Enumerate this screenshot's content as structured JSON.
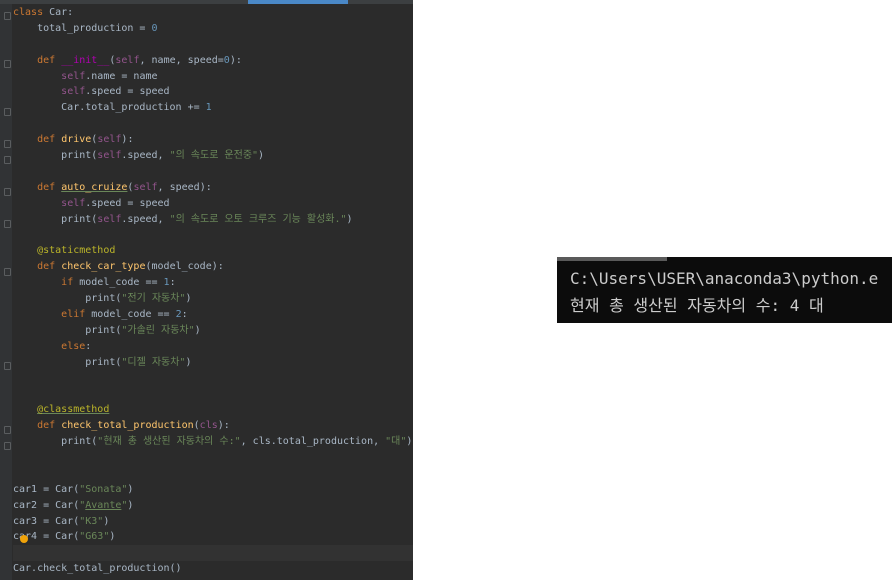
{
  "editor": {
    "lines": [
      [
        {
          "c": "kw",
          "t": "class "
        },
        {
          "c": "",
          "t": "Car:"
        }
      ],
      [
        {
          "c": "",
          "t": "    total_production = "
        },
        {
          "c": "num",
          "t": "0"
        }
      ],
      [],
      [
        {
          "c": "",
          "t": "    "
        },
        {
          "c": "kw",
          "t": "def "
        },
        {
          "c": "magic",
          "t": "__init__"
        },
        {
          "c": "",
          "t": "("
        },
        {
          "c": "self",
          "t": "self"
        },
        {
          "c": "",
          "t": ", name, speed="
        },
        {
          "c": "num",
          "t": "0"
        },
        {
          "c": "",
          "t": "):"
        }
      ],
      [
        {
          "c": "",
          "t": "        "
        },
        {
          "c": "self",
          "t": "self"
        },
        {
          "c": "",
          "t": ".name = name"
        }
      ],
      [
        {
          "c": "",
          "t": "        "
        },
        {
          "c": "self",
          "t": "self"
        },
        {
          "c": "",
          "t": ".speed = speed"
        }
      ],
      [
        {
          "c": "",
          "t": "        Car.total_production += "
        },
        {
          "c": "num",
          "t": "1"
        }
      ],
      [],
      [
        {
          "c": "",
          "t": "    "
        },
        {
          "c": "kw",
          "t": "def "
        },
        {
          "c": "fn",
          "t": "drive"
        },
        {
          "c": "",
          "t": "("
        },
        {
          "c": "self",
          "t": "self"
        },
        {
          "c": "",
          "t": "):"
        }
      ],
      [
        {
          "c": "",
          "t": "        print("
        },
        {
          "c": "self",
          "t": "self"
        },
        {
          "c": "",
          "t": ".speed, "
        },
        {
          "c": "str",
          "t": "\"의 속도로 운전중\""
        },
        {
          "c": "",
          "t": ")"
        }
      ],
      [],
      [
        {
          "c": "",
          "t": "    "
        },
        {
          "c": "kw",
          "t": "def "
        },
        {
          "c": "fn warn",
          "t": "auto_cruize"
        },
        {
          "c": "",
          "t": "("
        },
        {
          "c": "self",
          "t": "self"
        },
        {
          "c": "",
          "t": ", speed):"
        }
      ],
      [
        {
          "c": "",
          "t": "        "
        },
        {
          "c": "self",
          "t": "self"
        },
        {
          "c": "",
          "t": ".speed = speed"
        }
      ],
      [
        {
          "c": "",
          "t": "        print("
        },
        {
          "c": "self",
          "t": "self"
        },
        {
          "c": "",
          "t": ".speed, "
        },
        {
          "c": "str",
          "t": "\"의 속도로 오토 크루즈 기능 활성화.\""
        },
        {
          "c": "",
          "t": ")"
        }
      ],
      [],
      [
        {
          "c": "",
          "t": "    "
        },
        {
          "c": "dec",
          "t": "@staticmethod"
        }
      ],
      [
        {
          "c": "",
          "t": "    "
        },
        {
          "c": "kw",
          "t": "def "
        },
        {
          "c": "fn",
          "t": "check_car_type"
        },
        {
          "c": "",
          "t": "(model_code):"
        }
      ],
      [
        {
          "c": "",
          "t": "        "
        },
        {
          "c": "kw",
          "t": "if "
        },
        {
          "c": "",
          "t": "model_code == "
        },
        {
          "c": "num",
          "t": "1"
        },
        {
          "c": "",
          "t": ":"
        }
      ],
      [
        {
          "c": "",
          "t": "            print("
        },
        {
          "c": "str",
          "t": "\"전기 자동차\""
        },
        {
          "c": "",
          "t": ")"
        }
      ],
      [
        {
          "c": "",
          "t": "        "
        },
        {
          "c": "kw",
          "t": "elif "
        },
        {
          "c": "",
          "t": "model_code == "
        },
        {
          "c": "num",
          "t": "2"
        },
        {
          "c": "",
          "t": ":"
        }
      ],
      [
        {
          "c": "",
          "t": "            print("
        },
        {
          "c": "str",
          "t": "\"가솔린 자동차\""
        },
        {
          "c": "",
          "t": ")"
        }
      ],
      [
        {
          "c": "",
          "t": "        "
        },
        {
          "c": "kw",
          "t": "else"
        },
        {
          "c": "",
          "t": ":"
        }
      ],
      [
        {
          "c": "",
          "t": "            print("
        },
        {
          "c": "str",
          "t": "\"디젤 자동차\""
        },
        {
          "c": "",
          "t": ")"
        }
      ],
      [],
      [],
      [
        {
          "c": "",
          "t": "    "
        },
        {
          "c": "dec warn",
          "t": "@classmethod"
        }
      ],
      [
        {
          "c": "",
          "t": "    "
        },
        {
          "c": "kw",
          "t": "def "
        },
        {
          "c": "fn",
          "t": "check_total_production"
        },
        {
          "c": "",
          "t": "("
        },
        {
          "c": "self",
          "t": "cls"
        },
        {
          "c": "",
          "t": "):"
        }
      ],
      [
        {
          "c": "",
          "t": "        print("
        },
        {
          "c": "str",
          "t": "\"현재 총 생산된 자동차의 수:\""
        },
        {
          "c": "",
          "t": ", cls.total_production, "
        },
        {
          "c": "str",
          "t": "\"대\""
        },
        {
          "c": "",
          "t": ")"
        }
      ],
      [],
      [],
      [
        {
          "c": "",
          "t": "car1 = Car("
        },
        {
          "c": "str",
          "t": "\"Sonata\""
        },
        {
          "c": "",
          "t": ")"
        }
      ],
      [
        {
          "c": "",
          "t": "car2 = Car("
        },
        {
          "c": "str",
          "t": "\""
        },
        {
          "c": "str warn",
          "t": "Avante"
        },
        {
          "c": "str",
          "t": "\""
        },
        {
          "c": "",
          "t": ")"
        }
      ],
      [
        {
          "c": "",
          "t": "car3 = Car("
        },
        {
          "c": "str",
          "t": "\"K3\""
        },
        {
          "c": "",
          "t": ")"
        }
      ],
      [
        {
          "c": "",
          "t": "car4 = Car("
        },
        {
          "c": "str",
          "t": "\"G63\""
        },
        {
          "c": "",
          "t": ")"
        }
      ],
      [],
      [
        {
          "c": "",
          "t": "Car.check_total_production()"
        }
      ]
    ],
    "colors": {
      "background": "#2b2b2b",
      "keyword": "#cc7832",
      "function": "#ffc66d",
      "self": "#94558d",
      "string": "#6a8759",
      "number": "#6897bb",
      "decorator": "#bbb529"
    },
    "icons": [
      "lightbulb-icon",
      "fold-marker-icon"
    ]
  },
  "terminal": {
    "path_line": "C:\\Users\\USER\\anaconda3\\python.e",
    "output_line": "현재 총 생산된 자동차의 수: 4 대"
  }
}
